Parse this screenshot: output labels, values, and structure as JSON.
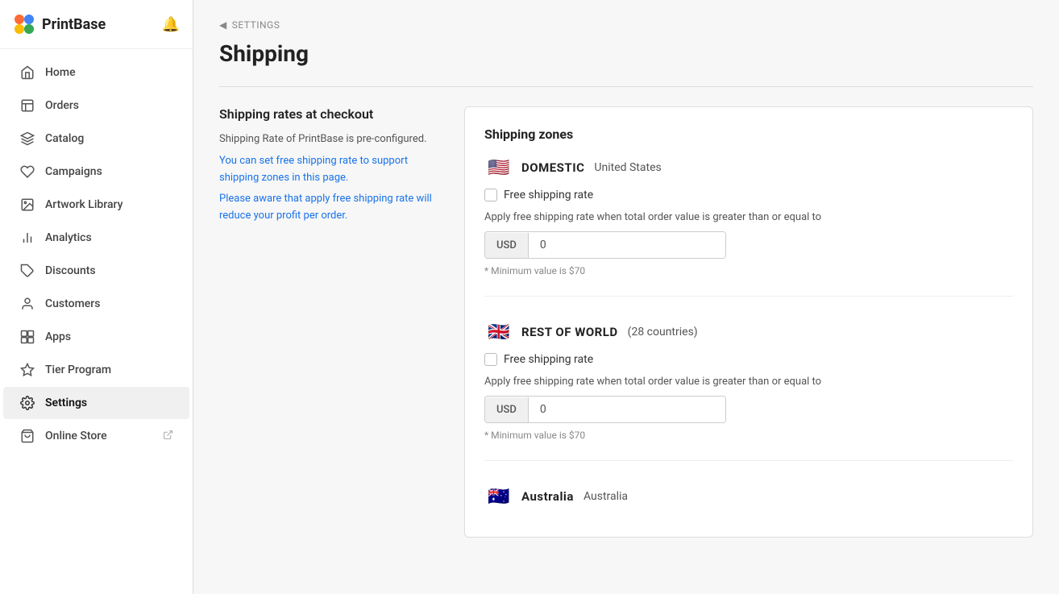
{
  "app": {
    "name": "PrintBase"
  },
  "sidebar": {
    "nav_items": [
      {
        "id": "home",
        "label": "Home",
        "icon": "home"
      },
      {
        "id": "orders",
        "label": "Orders",
        "icon": "orders"
      },
      {
        "id": "catalog",
        "label": "Catalog",
        "icon": "catalog"
      },
      {
        "id": "campaigns",
        "label": "Campaigns",
        "icon": "campaigns"
      },
      {
        "id": "artwork-library",
        "label": "Artwork Library",
        "icon": "artwork"
      },
      {
        "id": "analytics",
        "label": "Analytics",
        "icon": "analytics"
      },
      {
        "id": "discounts",
        "label": "Discounts",
        "icon": "discounts"
      },
      {
        "id": "customers",
        "label": "Customers",
        "icon": "customers"
      },
      {
        "id": "apps",
        "label": "Apps",
        "icon": "apps"
      },
      {
        "id": "tier-program",
        "label": "Tier Program",
        "icon": "tier"
      },
      {
        "id": "settings",
        "label": "Settings",
        "icon": "settings",
        "active": true
      },
      {
        "id": "online-store",
        "label": "Online Store",
        "icon": "store",
        "external": true
      }
    ]
  },
  "breadcrumb": {
    "parent": "SETTINGS",
    "arrow": "◀"
  },
  "page": {
    "title": "Shipping"
  },
  "left_panel": {
    "heading": "Shipping rates at checkout",
    "line1": "Shipping Rate of PrintBase is pre-configured.",
    "line2": "You can set free shipping rate to support shipping zones in this page.",
    "line3": "Please aware that apply free shipping rate will reduce your profit per order."
  },
  "right_panel": {
    "title": "Shipping zones",
    "zones": [
      {
        "id": "domestic",
        "flag": "🇺🇸",
        "name": "DOMESTIC",
        "sub": "United States",
        "checkbox_label": "Free shipping rate",
        "apply_text": "Apply free shipping rate when total order value is greater than or equal to",
        "currency": "USD",
        "value": "0",
        "min_note": "* Minimum value is $70"
      },
      {
        "id": "rest-of-world",
        "flag": "🇬🇧",
        "name": "REST OF WORLD",
        "sub": "(28 countries)",
        "checkbox_label": "Free shipping rate",
        "apply_text": "Apply free shipping rate when total order value is greater than or equal to",
        "currency": "USD",
        "value": "0",
        "min_note": "* Minimum value is $70"
      },
      {
        "id": "australia",
        "flag": "🇦🇺",
        "name": "Australia",
        "sub": "Australia",
        "checkbox_label": "",
        "apply_text": "",
        "currency": "",
        "value": "",
        "min_note": ""
      }
    ]
  }
}
